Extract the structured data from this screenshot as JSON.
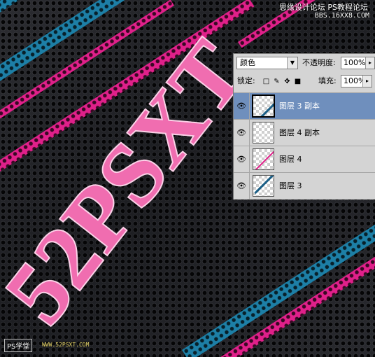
{
  "watermark": {
    "top_line1": "思缘设计论坛",
    "top_line1_b": "PS教程论坛",
    "top_line2": "BBS.16XX8.COM",
    "bottom_left": "PS学堂",
    "bottom_site": "WWW.52PSXT.COM"
  },
  "artwork_text": "52PSXT",
  "colors": {
    "stripe_blue": "#1d7fa6",
    "stripe_pink": "#e0208a",
    "text_pink": "#f06db0",
    "selection": "#6f8fbd"
  },
  "layers_panel": {
    "blend_mode": "颜色",
    "opacity_label": "不透明度:",
    "opacity_value": "100%",
    "lock_label": "锁定:",
    "fill_label": "填充:",
    "fill_value": "100%",
    "layers": [
      {
        "name": "图层 3 副本",
        "visible": true,
        "selected": true,
        "thumb": "blue-line-icon"
      },
      {
        "name": "图层 4 副本",
        "visible": true,
        "selected": false,
        "thumb": "empty-icon"
      },
      {
        "name": "图层 4",
        "visible": true,
        "selected": false,
        "thumb": "pink-line-icon"
      },
      {
        "name": "图层 3",
        "visible": true,
        "selected": false,
        "thumb": "blue-line-icon"
      }
    ]
  }
}
